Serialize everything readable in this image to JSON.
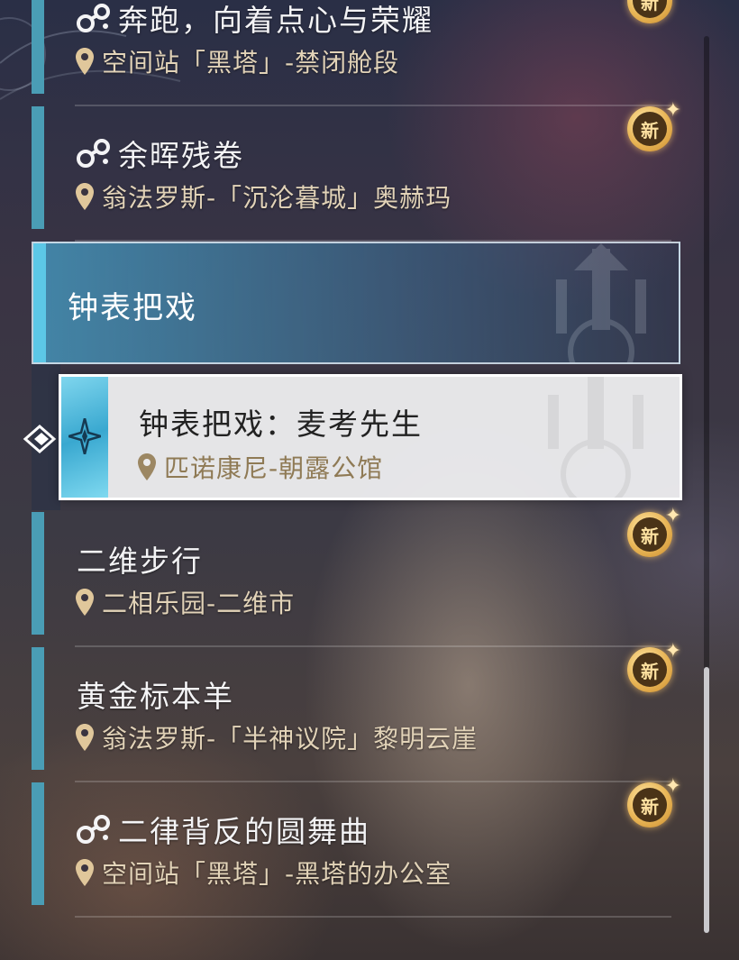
{
  "quests": [
    {
      "title": "奔跑，向着点心与荣耀",
      "location": "空间站「黑塔」-禁闭舱段",
      "icon": "main-quest-icon",
      "badge": "新",
      "new": true
    },
    {
      "title": "余晖残卷",
      "location": "翁法罗斯-「沉沦暮城」奥赫玛",
      "icon": "main-quest-icon",
      "badge": "新",
      "new": true
    }
  ],
  "category": {
    "label": "钟表把戏"
  },
  "selected_quest": {
    "title": "钟表把戏：麦考先生",
    "location": "匹诺康尼-朝露公馆"
  },
  "quests_below": [
    {
      "title": "二维步行",
      "location": "二相乐园-二维市",
      "badge": "新",
      "new": true
    },
    {
      "title": "黄金标本羊",
      "location": "翁法罗斯-「半神议院」黎明云崖",
      "badge": "新",
      "new": true
    },
    {
      "title": "二律背反的圆舞曲",
      "location": "空间站「黑塔」-黑塔的办公室",
      "icon": "main-quest-icon",
      "badge": "新",
      "new": true
    }
  ],
  "colors": {
    "accent": "#4a9db5",
    "header_accent": "#5cc7e6",
    "badge_gold": "#e8b556",
    "location_text": "#e2d3b8"
  }
}
